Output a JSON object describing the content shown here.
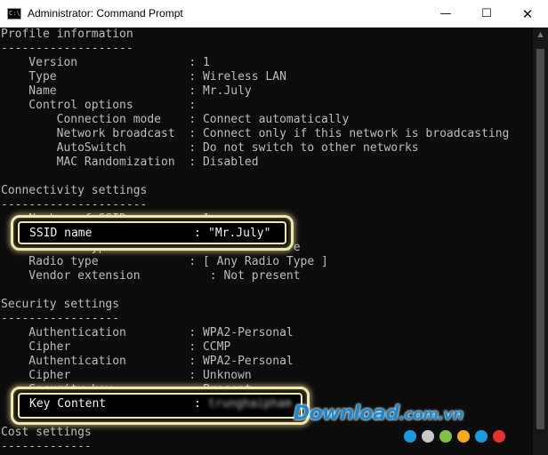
{
  "window": {
    "title": "Administrator: Command Prompt",
    "icon_text": "C:\\",
    "minimize": "—",
    "maximize": "☐",
    "close": "✕"
  },
  "lines": [
    "Profile information",
    "-------------------",
    "    Version                : 1",
    "    Type                   : Wireless LAN",
    "    Name                   : Mr.July",
    "    Control options        :",
    "        Connection mode    : Connect automatically",
    "        Network broadcast  : Connect only if this network is broadcasting",
    "        AutoSwitch         : Do not switch to other networks",
    "        MAC Randomization  : Disabled",
    "",
    "Connectivity settings",
    "---------------------",
    "    Number of SSIDs        : 1",
    "",
    "    Network type           : Infrastructure",
    "    Radio type             : [ Any Radio Type ]",
    "    Vendor extension          : Not present",
    "",
    "Security settings",
    "-----------------",
    "    Authentication         : WPA2-Personal",
    "    Cipher                 : CCMP",
    "    Authentication         : WPA2-Personal",
    "    Cipher                 : Unknown",
    "    Security key           : Present",
    "",
    "",
    "Cost settings",
    "-------------"
  ],
  "highlight_ssid": {
    "label": "SSID name",
    "sep": ":",
    "value": "\"Mr.July\""
  },
  "highlight_key": {
    "label": "Key Content",
    "sep": ":",
    "value": "trunghaipham"
  },
  "watermark": {
    "text": "Download",
    "domain": ".com.vn"
  },
  "watermark_dots": [
    "#1a9be0",
    "#c8c8c8",
    "#7dc242",
    "#f7a81b",
    "#1a9be0",
    "#e8312f"
  ],
  "colors": {
    "console_bg": "#0c0c0c",
    "text": "#bdbdbd",
    "highlight": "#efe8a8"
  }
}
